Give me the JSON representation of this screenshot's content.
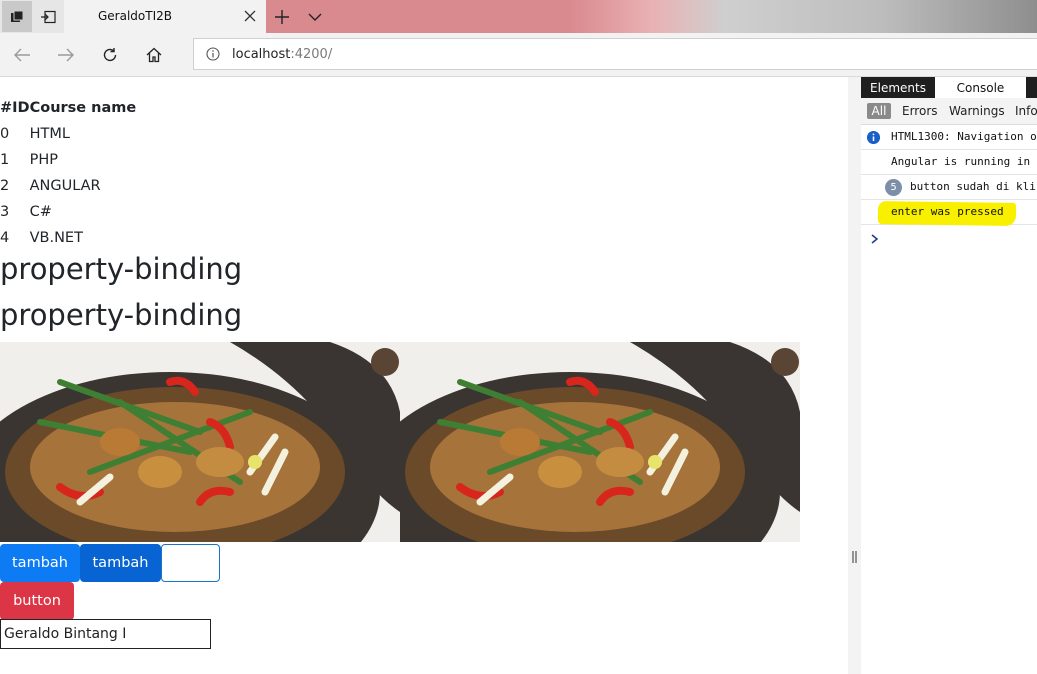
{
  "browser": {
    "tab_title": "GeraldoTI2B",
    "url_host": "localhost",
    "url_port": ":4200/"
  },
  "page": {
    "table": {
      "headers": [
        "#ID",
        "Course name"
      ],
      "rows": [
        {
          "id": "0",
          "name": "HTML"
        },
        {
          "id": "1",
          "name": "PHP"
        },
        {
          "id": "2",
          "name": "ANGULAR"
        },
        {
          "id": "3",
          "name": "C#"
        },
        {
          "id": "4",
          "name": "VB.NET"
        }
      ]
    },
    "headings": [
      "property-binding",
      "property-binding"
    ],
    "buttons": {
      "tambah_1": "tambah",
      "tambah_2": "tambah",
      "empty": "",
      "button": "button"
    },
    "name_input_value": "Geraldo Bintang I"
  },
  "devtools": {
    "tabs": [
      "Elements",
      "Console"
    ],
    "filters": [
      "All",
      "Errors",
      "Warnings",
      "Info"
    ],
    "console": [
      {
        "text": "HTML1300: Navigation o",
        "icon": "info-icon"
      },
      {
        "text": "Angular is running in"
      },
      {
        "text": "button sudah di klik",
        "count": "5"
      },
      {
        "text": "enter was pressed",
        "highlighted": true
      }
    ]
  },
  "colors": {
    "primary": "#0d7bf4",
    "primary_dark": "#0864d3",
    "danger": "#dc3545",
    "highlight": "#f9f000"
  }
}
